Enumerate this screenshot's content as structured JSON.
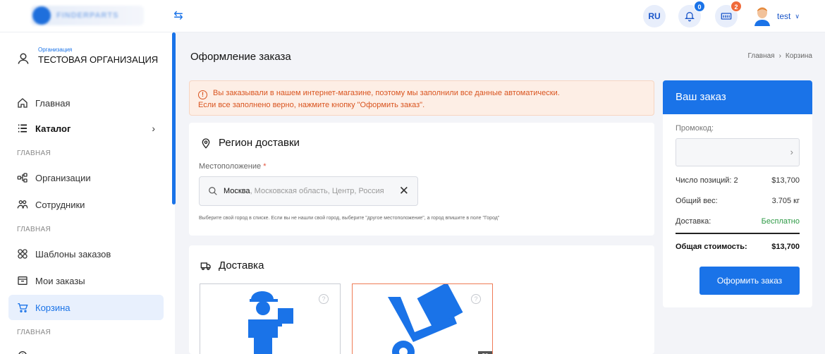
{
  "brand": {
    "logo_text": "FINDERPARTS",
    "accent": "#1a73e8"
  },
  "topbar": {
    "lang": "RU",
    "notifications_count": "0",
    "cart_count": "2",
    "user_name": "test"
  },
  "sidebar": {
    "org_caption": "Организация",
    "org_name": "ТЕСТОВАЯ ОРГАНИЗАЦИЯ",
    "items": [
      {
        "label": "Главная",
        "icon": "home-icon"
      },
      {
        "label": "Каталог",
        "icon": "list-icon"
      },
      {
        "label": "Организации",
        "icon": "org-tree-icon"
      },
      {
        "label": "Сотрудники",
        "icon": "users-icon"
      },
      {
        "label": "Шаблоны заказов",
        "icon": "templates-icon"
      },
      {
        "label": "Мои заказы",
        "icon": "orders-icon"
      },
      {
        "label": "Корзина",
        "icon": "cart-icon"
      }
    ],
    "sections": [
      "ГЛАВНАЯ",
      "ГЛАВНАЯ",
      "ГЛАВНАЯ"
    ]
  },
  "page": {
    "title": "Оформление заказа",
    "breadcrumb": [
      "Главная",
      "Корзина"
    ]
  },
  "alert": {
    "line1": "Вы заказывали в нашем интернет-магазине, поэтому мы заполнили все данные автоматически.",
    "line2": "Если все заполнено верно, нажмите кнопку \"Оформить заказ\"."
  },
  "region": {
    "title": "Регион доставки",
    "location_label": "Местоположение",
    "required_mark": "*",
    "city": "Москва",
    "city_rest": ", Московская область, Центр, Россия",
    "hint": "Выберите свой город в списке. Если вы не нашли свой город, выберите \"другое местоположение\", а город впишите в поле \"Город\""
  },
  "delivery": {
    "title": "Доставка",
    "option2_price": "$0"
  },
  "order": {
    "title": "Ваш заказ",
    "promo_label": "Промокод:",
    "items_label": "Число позиций: 2",
    "items_value": "$13,700",
    "weight_label": "Общий вес:",
    "weight_value": "3.705 кг",
    "delivery_label": "Доставка:",
    "delivery_value": "Бесплатно",
    "total_label": "Общая стоимость:",
    "total_value": "$13,700",
    "checkout_label": "Оформить заказ"
  }
}
